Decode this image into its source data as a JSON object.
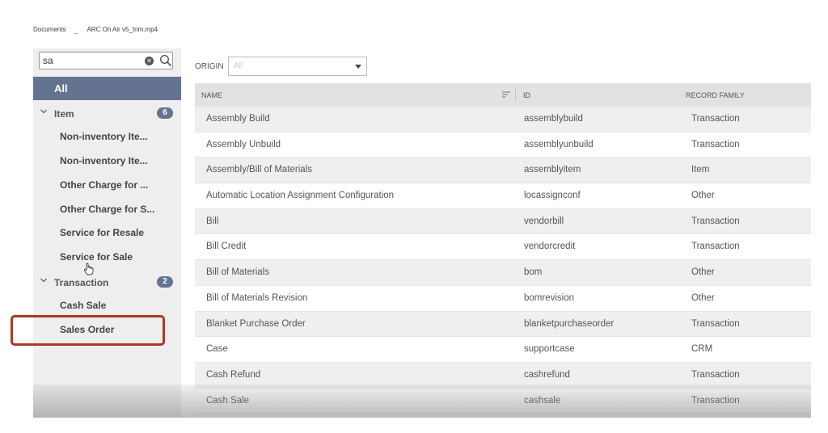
{
  "breadcrumb": {
    "item1": "Documents",
    "item2": "ARC On Air v5_trim.mp4"
  },
  "search": {
    "value": "sa"
  },
  "sidebar": {
    "all_label": "All",
    "groups": [
      {
        "label": "Item",
        "count": "6",
        "items": [
          "Non-inventory Ite...",
          "Non-inventory Ite...",
          "Other Charge for ...",
          "Other Charge for S...",
          "Service for Resale",
          "Service for Sale"
        ]
      },
      {
        "label": "Transaction",
        "count": "2",
        "items": [
          "Cash Sale",
          "Sales Order"
        ]
      }
    ]
  },
  "origin": {
    "label": "ORIGIN",
    "value": "All"
  },
  "table": {
    "headers": [
      "NAME",
      "ID",
      "RECORD FAMILY"
    ],
    "rows": [
      [
        "Assembly Build",
        "assemblybuild",
        "Transaction"
      ],
      [
        "Assembly Unbuild",
        "assemblyunbuild",
        "Transaction"
      ],
      [
        "Assembly/Bill of Materials",
        "assemblyitem",
        "Item"
      ],
      [
        "Automatic Location Assignment Configuration",
        "locassignconf",
        "Other"
      ],
      [
        "Bill",
        "vendorbill",
        "Transaction"
      ],
      [
        "Bill Credit",
        "vendorcredit",
        "Transaction"
      ],
      [
        "Bill of Materials",
        "bom",
        "Other"
      ],
      [
        "Bill of Materials Revision",
        "bomrevision",
        "Other"
      ],
      [
        "Blanket Purchase Order",
        "blanketpurchaseorder",
        "Transaction"
      ],
      [
        "Case",
        "supportcase",
        "CRM"
      ],
      [
        "Cash Refund",
        "cashrefund",
        "Transaction"
      ],
      [
        "Cash Sale",
        "cashsale",
        "Transaction"
      ]
    ]
  },
  "colors": {
    "accent": "#647390",
    "highlight_border": "#a33d22"
  }
}
